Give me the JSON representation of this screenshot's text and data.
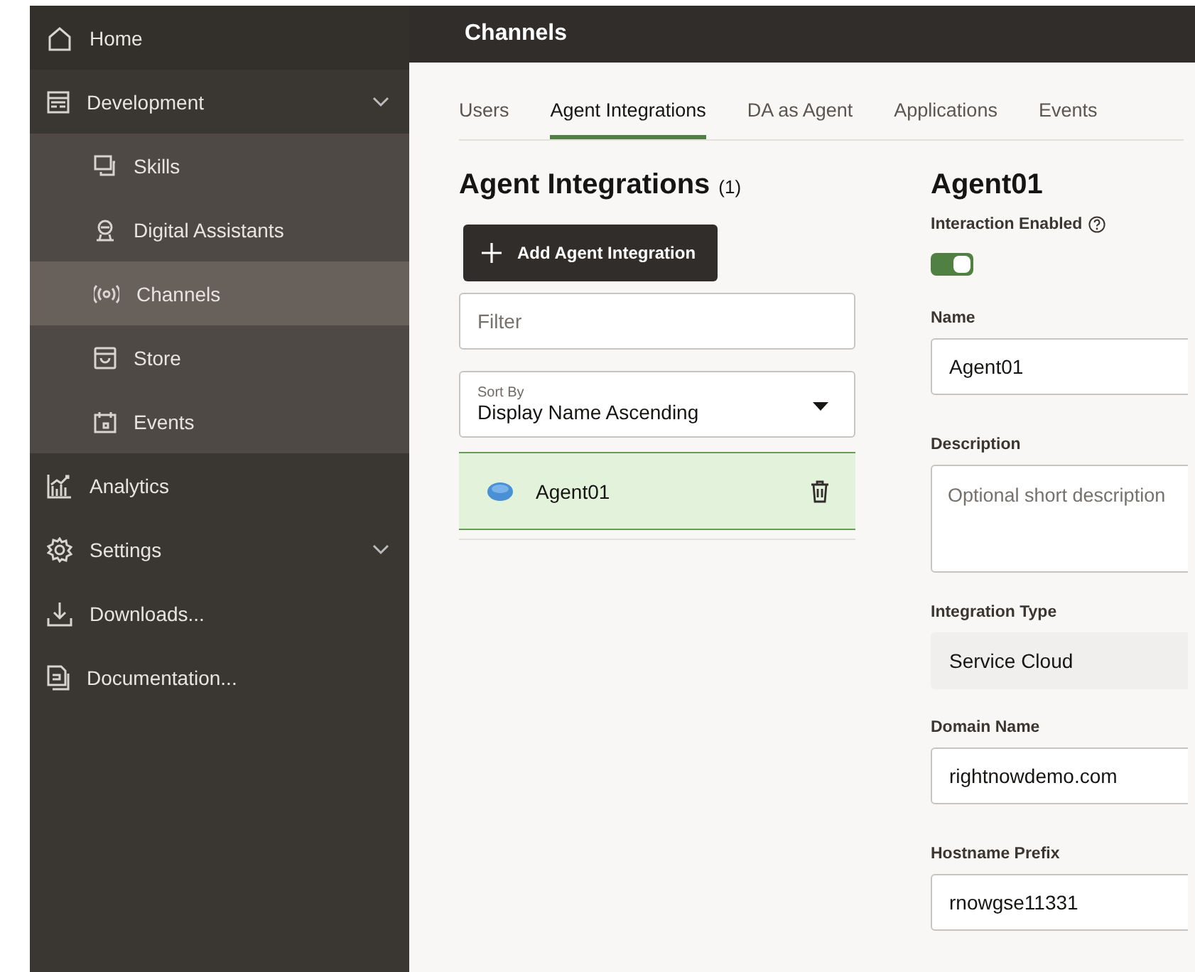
{
  "sidebar": {
    "items": [
      {
        "label": "Home",
        "selected": false
      },
      {
        "label": "Development",
        "selected": false,
        "has_submenu": true,
        "children": [
          {
            "label": "Skills",
            "selected": false
          },
          {
            "label": "Digital Assistants",
            "selected": false
          },
          {
            "label": "Channels",
            "selected": true
          },
          {
            "label": "Store",
            "selected": false
          },
          {
            "label": "Events",
            "selected": false
          }
        ]
      },
      {
        "label": "Analytics",
        "selected": false
      },
      {
        "label": "Settings",
        "selected": false,
        "has_submenu": true
      },
      {
        "label": "Downloads...",
        "selected": false
      },
      {
        "label": "Documentation...",
        "selected": false
      }
    ]
  },
  "header": {
    "title": "Channels"
  },
  "tabs": [
    {
      "label": "Users",
      "selected": false
    },
    {
      "label": "Agent Integrations",
      "selected": true
    },
    {
      "label": "DA as Agent",
      "selected": false
    },
    {
      "label": "Applications",
      "selected": false
    },
    {
      "label": "Events",
      "selected": false
    }
  ],
  "list_panel": {
    "title": "Agent Integrations",
    "count": "(1)",
    "add_button": "Add Agent Integration",
    "filter": {
      "placeholder": "Filter"
    },
    "sort": {
      "label": "Sort By",
      "value": "Display Name Ascending"
    },
    "items": [
      {
        "name": "Agent01",
        "selected": true
      }
    ]
  },
  "detail": {
    "title": "Agent01",
    "toggle": {
      "label": "Interaction Enabled",
      "on": true
    },
    "fields": [
      {
        "label": "Name",
        "kind": "input",
        "value": "Agent01"
      },
      {
        "label": "Description",
        "kind": "textarea",
        "placeholder": "Optional short description"
      },
      {
        "label": "Integration Type",
        "kind": "readonly",
        "value": "Service Cloud"
      },
      {
        "label": "Domain Name",
        "kind": "input",
        "value": "rightnowdemo.com"
      },
      {
        "label": "Hostname Prefix",
        "kind": "input",
        "value": "rnowgse11331"
      }
    ]
  }
}
